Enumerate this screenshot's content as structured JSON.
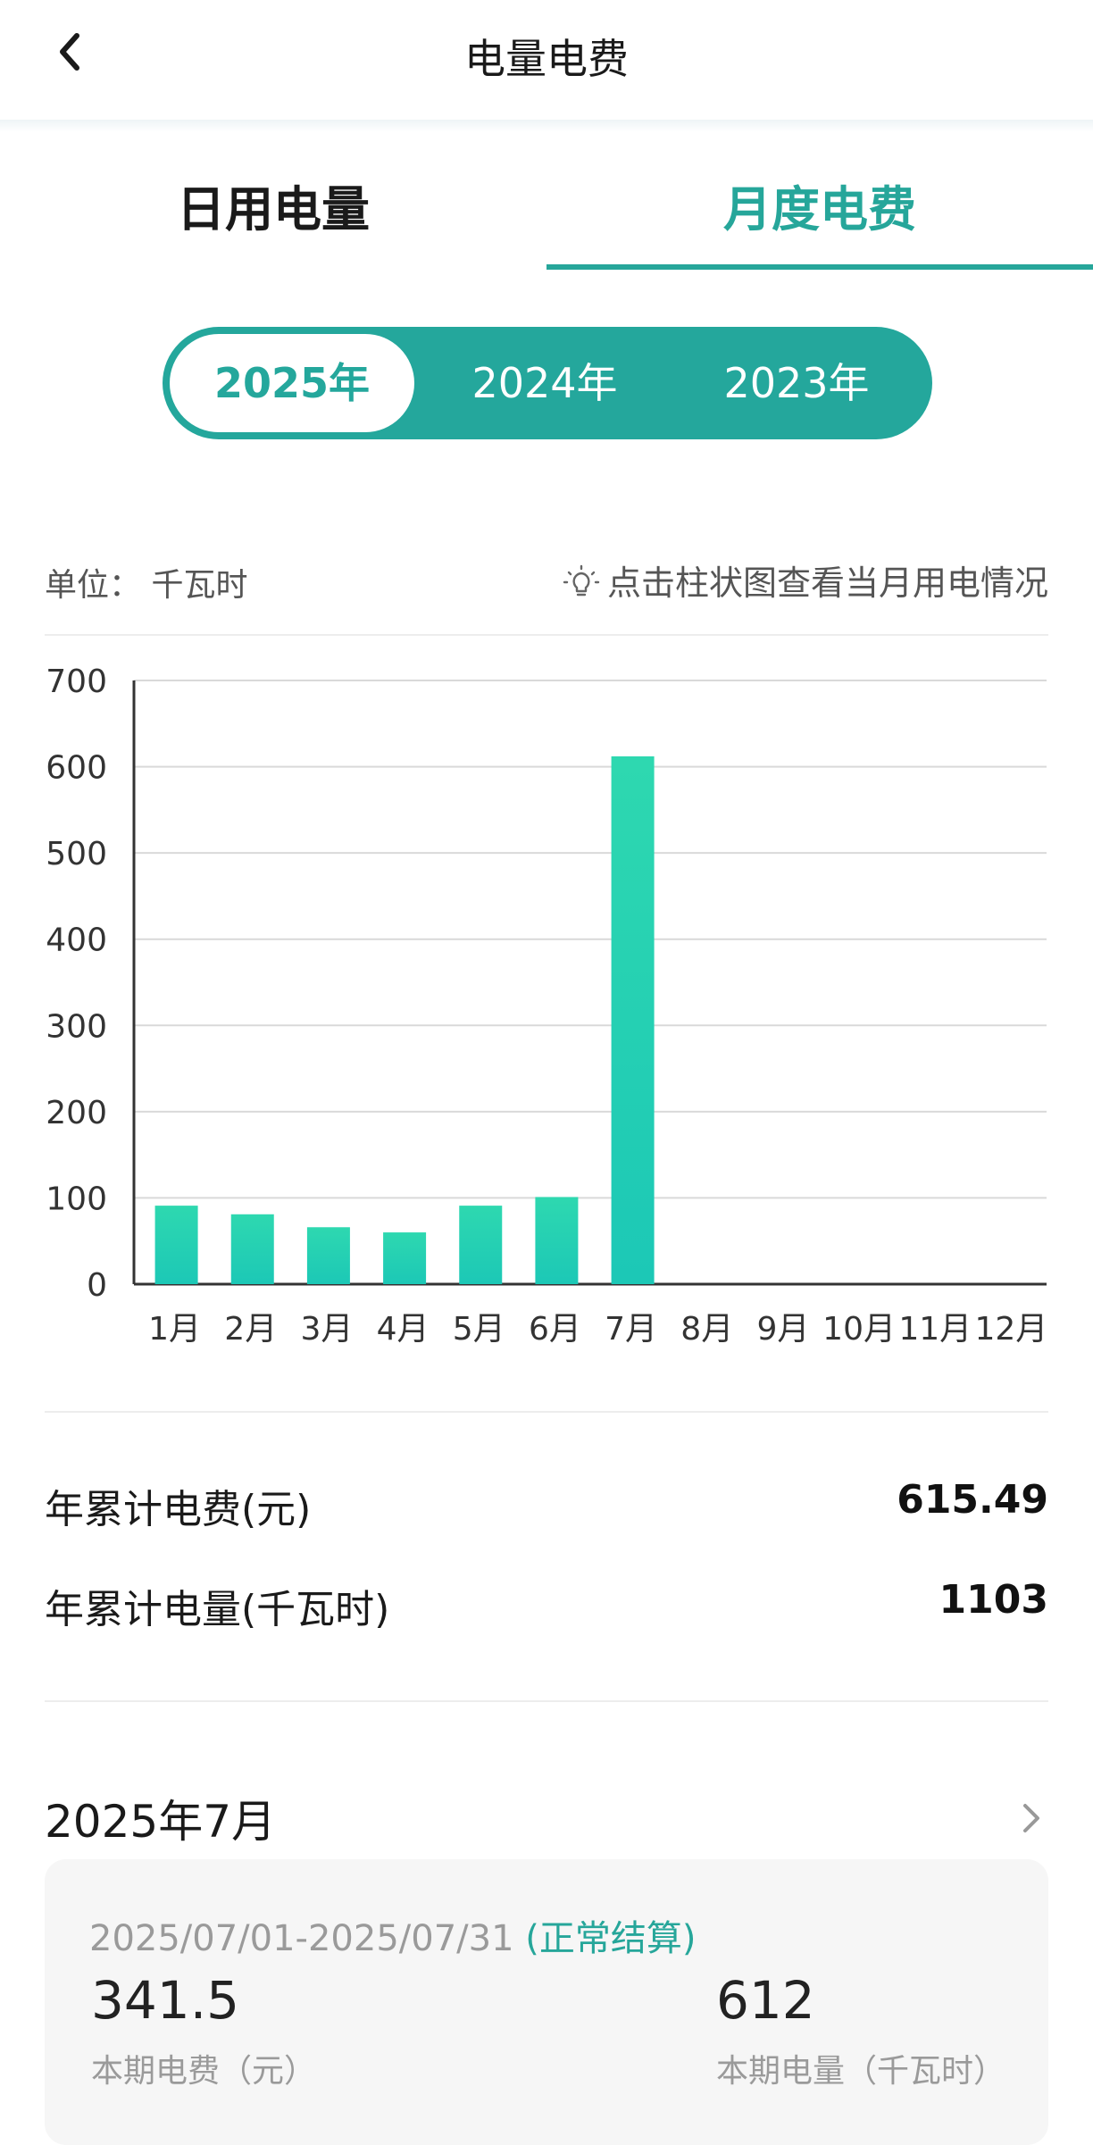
{
  "header": {
    "title": "电量电费"
  },
  "tabs": [
    {
      "label": "日用电量",
      "active": false
    },
    {
      "label": "月度电费",
      "active": true
    }
  ],
  "years": [
    "2025年",
    "2024年",
    "2023年"
  ],
  "selected_year": "2025年",
  "chart_header": {
    "unit": "单位：  千瓦时",
    "hint": "点击柱状图查看当月用电情况"
  },
  "chart_data": {
    "type": "bar",
    "categories": [
      "1月",
      "2月",
      "3月",
      "4月",
      "5月",
      "6月",
      "7月",
      "8月",
      "9月",
      "10月",
      "11月",
      "12月"
    ],
    "values": [
      91,
      81,
      66,
      60,
      91,
      101,
      612,
      null,
      null,
      null,
      null,
      null
    ],
    "ylim": [
      0,
      700
    ],
    "yticks": [
      0,
      100,
      200,
      300,
      400,
      500,
      600,
      700
    ],
    "grid": true,
    "bar_color": "#2bd4b0",
    "title": "",
    "xlabel": "",
    "ylabel": ""
  },
  "summary": {
    "fee_label": "年累计电费(元)",
    "fee_value": "615.49",
    "kwh_label": "年累计电量(千瓦时)",
    "kwh_value": "1103"
  },
  "period": {
    "title": "2025年7月",
    "range": "2025/07/01-2025/07/31",
    "status": "(正常结算)",
    "fee": "341.5",
    "fee_label": "本期电费（元）",
    "kwh": "612",
    "kwh_label": "本期电量（千瓦时）"
  },
  "colors": {
    "accent": "#26a69a",
    "bar": "#2bd4b0"
  }
}
